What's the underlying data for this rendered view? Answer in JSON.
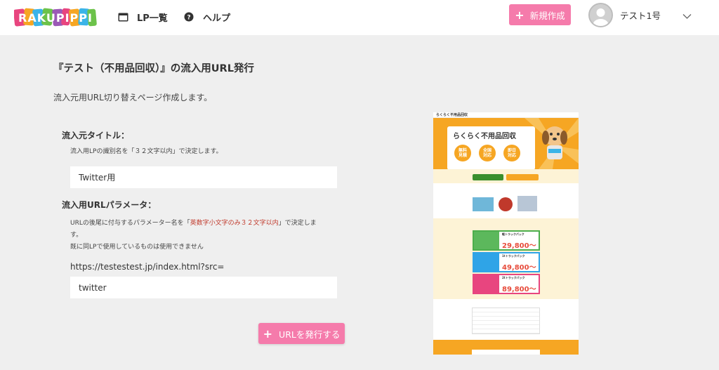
{
  "header": {
    "logo_text": "RAKUPIPPI",
    "nav": [
      {
        "label": "LP一覧",
        "icon": "window-icon"
      },
      {
        "label": "ヘルプ",
        "icon": "question-circle-icon"
      }
    ],
    "new_button_label": "新規作成",
    "user_name": "テスト1号"
  },
  "main": {
    "title": "『テスト（不用品回収）』の流入用URL発行",
    "description": "流入元用URL切り替えページ作成します。",
    "source_title": {
      "label": "流入元タイトル：",
      "help": "流入用LPの識別名を「３２文字以内」で決定します。",
      "value": "Twitter用"
    },
    "url_param": {
      "label": "流入用URLパラメータ：",
      "help_before": "URLの後尾に付与するパラメーター名を「",
      "help_red": "英数字小文字のみ３２文字以内",
      "help_after": "」で決定しま",
      "help_wrap": "す。",
      "help_line2": "既に同LPで使用しているものは使用できません",
      "base_url": "https://testestest.jp/index.html?src=",
      "value": "twitter"
    },
    "issue_button_label": "URLを発行する"
  },
  "preview": {
    "site_title": "らくらく不用品回収",
    "hero_text": "らくらく不用品回収",
    "badges": [
      "無料\n見積",
      "全国\n対応",
      "即日\n対応"
    ],
    "plans": [
      {
        "name": "軽トラックパック",
        "price": "29,800〜"
      },
      {
        "name": "1tトラックパック",
        "price": "49,800〜"
      },
      {
        "name": "2tトラックパック",
        "price": "89,800〜"
      }
    ]
  },
  "colors": {
    "accent_pink": "#f57bab",
    "page_bg": "#efefef",
    "preview_orange": "#f6a623"
  }
}
